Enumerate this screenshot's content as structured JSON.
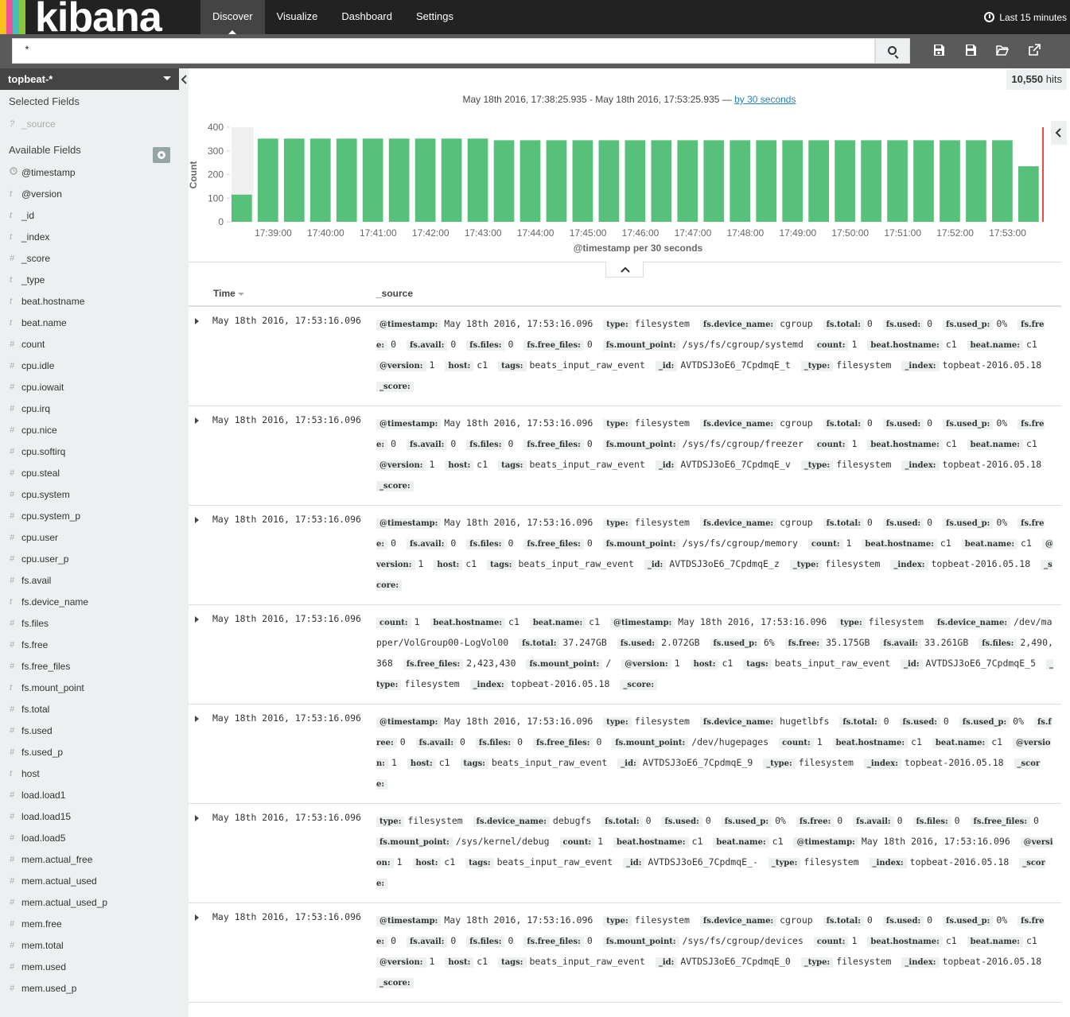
{
  "app": {
    "logo_text": "kibana",
    "logo_colors": [
      "#f9c01e",
      "#ef5098",
      "#49c0b6",
      "#8cc63e"
    ]
  },
  "nav": {
    "items": [
      {
        "label": "Discover",
        "active": true
      },
      {
        "label": "Visualize",
        "active": false
      },
      {
        "label": "Dashboard",
        "active": false
      },
      {
        "label": "Settings",
        "active": false
      }
    ],
    "timepicker": "Last 15 minutes"
  },
  "search": {
    "query": "*",
    "icons": [
      "search-icon",
      "new-search-icon",
      "save-search-icon",
      "open-search-icon",
      "share-search-icon"
    ]
  },
  "sidebar": {
    "index_pattern": "topbeat-*",
    "selected_title": "Selected Fields",
    "selected_fields": [
      {
        "type": "?",
        "name": "_source"
      }
    ],
    "available_title": "Available Fields",
    "available_fields": [
      {
        "type": "clock",
        "name": "@timestamp"
      },
      {
        "type": "t",
        "name": "@version"
      },
      {
        "type": "t",
        "name": "_id"
      },
      {
        "type": "t",
        "name": "_index"
      },
      {
        "type": "#",
        "name": "_score"
      },
      {
        "type": "t",
        "name": "_type"
      },
      {
        "type": "t",
        "name": "beat.hostname"
      },
      {
        "type": "t",
        "name": "beat.name"
      },
      {
        "type": "#",
        "name": "count"
      },
      {
        "type": "#",
        "name": "cpu.idle"
      },
      {
        "type": "#",
        "name": "cpu.iowait"
      },
      {
        "type": "#",
        "name": "cpu.irq"
      },
      {
        "type": "#",
        "name": "cpu.nice"
      },
      {
        "type": "#",
        "name": "cpu.softirq"
      },
      {
        "type": "#",
        "name": "cpu.steal"
      },
      {
        "type": "#",
        "name": "cpu.system"
      },
      {
        "type": "#",
        "name": "cpu.system_p"
      },
      {
        "type": "#",
        "name": "cpu.user"
      },
      {
        "type": "#",
        "name": "cpu.user_p"
      },
      {
        "type": "#",
        "name": "fs.avail"
      },
      {
        "type": "t",
        "name": "fs.device_name"
      },
      {
        "type": "#",
        "name": "fs.files"
      },
      {
        "type": "#",
        "name": "fs.free"
      },
      {
        "type": "#",
        "name": "fs.free_files"
      },
      {
        "type": "t",
        "name": "fs.mount_point"
      },
      {
        "type": "#",
        "name": "fs.total"
      },
      {
        "type": "#",
        "name": "fs.used"
      },
      {
        "type": "#",
        "name": "fs.used_p"
      },
      {
        "type": "t",
        "name": "host"
      },
      {
        "type": "#",
        "name": "load.load1"
      },
      {
        "type": "#",
        "name": "load.load15"
      },
      {
        "type": "#",
        "name": "load.load5"
      },
      {
        "type": "#",
        "name": "mem.actual_free"
      },
      {
        "type": "#",
        "name": "mem.actual_used"
      },
      {
        "type": "#",
        "name": "mem.actual_used_p"
      },
      {
        "type": "#",
        "name": "mem.free"
      },
      {
        "type": "#",
        "name": "mem.total"
      },
      {
        "type": "#",
        "name": "mem.used"
      },
      {
        "type": "#",
        "name": "mem.used_p"
      }
    ]
  },
  "results": {
    "hits_count": "10,550",
    "hits_label": "hits",
    "date_range": "May 18th 2016, 17:38:25.935 - May 18th 2016, 17:53:25.935 —",
    "interval_link": "by 30 seconds"
  },
  "chart_data": {
    "type": "bar",
    "ylabel": "Count",
    "xlabel": "@timestamp per 30 seconds",
    "ylim": [
      0,
      400
    ],
    "yticks": [
      0,
      100,
      200,
      300,
      400
    ],
    "xticks": [
      "17:39:00",
      "17:40:00",
      "17:41:00",
      "17:42:00",
      "17:43:00",
      "17:44:00",
      "17:45:00",
      "17:46:00",
      "17:47:00",
      "17:48:00",
      "17:49:00",
      "17:50:00",
      "17:51:00",
      "17:52:00",
      "17:53:00"
    ],
    "values": [
      115,
      352,
      352,
      352,
      352,
      352,
      352,
      352,
      352,
      352,
      345,
      345,
      345,
      345,
      345,
      345,
      345,
      345,
      345,
      345,
      345,
      345,
      345,
      345,
      345,
      345,
      345,
      345,
      345,
      345,
      235
    ],
    "bar_color": "#57c17b",
    "partial_color": "#f0f0f0",
    "now_marker_color": "#e74c3c"
  },
  "table": {
    "col_time": "Time",
    "col_source": "_source",
    "rows": [
      {
        "time": "May 18th 2016, 17:53:16.096",
        "fields": [
          [
            "@timestamp:",
            "May 18th 2016, 17:53:16.096"
          ],
          [
            "type:",
            "filesystem"
          ],
          [
            "fs.device_name:",
            "cgroup"
          ],
          [
            "fs.total:",
            "0"
          ],
          [
            "fs.used:",
            "0"
          ],
          [
            "fs.used_p:",
            "0%"
          ],
          [
            "fs.free:",
            "0"
          ],
          [
            "fs.avail:",
            "0"
          ],
          [
            "fs.files:",
            "0"
          ],
          [
            "fs.free_files:",
            "0"
          ],
          [
            "fs.mount_point:",
            "/sys/fs/cgroup/systemd"
          ],
          [
            "count:",
            "1"
          ],
          [
            "beat.hostname:",
            "c1"
          ],
          [
            "beat.name:",
            "c1"
          ],
          [
            "@version:",
            "1"
          ],
          [
            "host:",
            "c1"
          ],
          [
            "tags:",
            "beats_input_raw_event"
          ],
          [
            "_id:",
            "AVTDSJ3oE6_7CpdmqE_t"
          ],
          [
            "_type:",
            "filesystem"
          ],
          [
            "_index:",
            "topbeat-2016.05.18"
          ],
          [
            "_score:",
            ""
          ]
        ]
      },
      {
        "time": "May 18th 2016, 17:53:16.096",
        "fields": [
          [
            "@timestamp:",
            "May 18th 2016, 17:53:16.096"
          ],
          [
            "type:",
            "filesystem"
          ],
          [
            "fs.device_name:",
            "cgroup"
          ],
          [
            "fs.total:",
            "0"
          ],
          [
            "fs.used:",
            "0"
          ],
          [
            "fs.used_p:",
            "0%"
          ],
          [
            "fs.free:",
            "0"
          ],
          [
            "fs.avail:",
            "0"
          ],
          [
            "fs.files:",
            "0"
          ],
          [
            "fs.free_files:",
            "0"
          ],
          [
            "fs.mount_point:",
            "/sys/fs/cgroup/freezer"
          ],
          [
            "count:",
            "1"
          ],
          [
            "beat.hostname:",
            "c1"
          ],
          [
            "beat.name:",
            "c1"
          ],
          [
            "@version:",
            "1"
          ],
          [
            "host:",
            "c1"
          ],
          [
            "tags:",
            "beats_input_raw_event"
          ],
          [
            "_id:",
            "AVTDSJ3oE6_7CpdmqE_v"
          ],
          [
            "_type:",
            "filesystem"
          ],
          [
            "_index:",
            "topbeat-2016.05.18"
          ],
          [
            "_score:",
            ""
          ]
        ]
      },
      {
        "time": "May 18th 2016, 17:53:16.096",
        "fields": [
          [
            "@timestamp:",
            "May 18th 2016, 17:53:16.096"
          ],
          [
            "type:",
            "filesystem"
          ],
          [
            "fs.device_name:",
            "cgroup"
          ],
          [
            "fs.total:",
            "0"
          ],
          [
            "fs.used:",
            "0"
          ],
          [
            "fs.used_p:",
            "0%"
          ],
          [
            "fs.free:",
            "0"
          ],
          [
            "fs.avail:",
            "0"
          ],
          [
            "fs.files:",
            "0"
          ],
          [
            "fs.free_files:",
            "0"
          ],
          [
            "fs.mount_point:",
            "/sys/fs/cgroup/memory"
          ],
          [
            "count:",
            "1"
          ],
          [
            "beat.hostname:",
            "c1"
          ],
          [
            "beat.name:",
            "c1"
          ],
          [
            "@version:",
            "1"
          ],
          [
            "host:",
            "c1"
          ],
          [
            "tags:",
            "beats_input_raw_event"
          ],
          [
            "_id:",
            "AVTDSJ3oE6_7CpdmqE_z"
          ],
          [
            "_type:",
            "filesystem"
          ],
          [
            "_index:",
            "topbeat-2016.05.18"
          ],
          [
            "_score:",
            ""
          ]
        ]
      },
      {
        "time": "May 18th 2016, 17:53:16.096",
        "fields": [
          [
            "count:",
            "1"
          ],
          [
            "beat.hostname:",
            "c1"
          ],
          [
            "beat.name:",
            "c1"
          ],
          [
            "@timestamp:",
            "May 18th 2016, 17:53:16.096"
          ],
          [
            "type:",
            "filesystem"
          ],
          [
            "fs.device_name:",
            "/dev/mapper/VolGroup00-LogVol00"
          ],
          [
            "fs.total:",
            "37.247GB"
          ],
          [
            "fs.used:",
            "2.072GB"
          ],
          [
            "fs.used_p:",
            "6%"
          ],
          [
            "fs.free:",
            "35.175GB"
          ],
          [
            "fs.avail:",
            "33.261GB"
          ],
          [
            "fs.files:",
            "2,490,368"
          ],
          [
            "fs.free_files:",
            "2,423,430"
          ],
          [
            "fs.mount_point:",
            "/"
          ],
          [
            "@version:",
            "1"
          ],
          [
            "host:",
            "c1"
          ],
          [
            "tags:",
            "beats_input_raw_event"
          ],
          [
            "_id:",
            "AVTDSJ3oE6_7CpdmqE_5"
          ],
          [
            "_type:",
            "filesystem"
          ],
          [
            "_index:",
            "topbeat-2016.05.18"
          ],
          [
            "_score:",
            ""
          ]
        ]
      },
      {
        "time": "May 18th 2016, 17:53:16.096",
        "fields": [
          [
            "@timestamp:",
            "May 18th 2016, 17:53:16.096"
          ],
          [
            "type:",
            "filesystem"
          ],
          [
            "fs.device_name:",
            "hugetlbfs"
          ],
          [
            "fs.total:",
            "0"
          ],
          [
            "fs.used:",
            "0"
          ],
          [
            "fs.used_p:",
            "0%"
          ],
          [
            "fs.free:",
            "0"
          ],
          [
            "fs.avail:",
            "0"
          ],
          [
            "fs.files:",
            "0"
          ],
          [
            "fs.free_files:",
            "0"
          ],
          [
            "fs.mount_point:",
            "/dev/hugepages"
          ],
          [
            "count:",
            "1"
          ],
          [
            "beat.hostname:",
            "c1"
          ],
          [
            "beat.name:",
            "c1"
          ],
          [
            "@version:",
            "1"
          ],
          [
            "host:",
            "c1"
          ],
          [
            "tags:",
            "beats_input_raw_event"
          ],
          [
            "_id:",
            "AVTDSJ3oE6_7CpdmqE_9"
          ],
          [
            "_type:",
            "filesystem"
          ],
          [
            "_index:",
            "topbeat-2016.05.18"
          ],
          [
            "_score:",
            ""
          ]
        ]
      },
      {
        "time": "May 18th 2016, 17:53:16.096",
        "fields": [
          [
            "type:",
            "filesystem"
          ],
          [
            "fs.device_name:",
            "debugfs"
          ],
          [
            "fs.total:",
            "0"
          ],
          [
            "fs.used:",
            "0"
          ],
          [
            "fs.used_p:",
            "0%"
          ],
          [
            "fs.free:",
            "0"
          ],
          [
            "fs.avail:",
            "0"
          ],
          [
            "fs.files:",
            "0"
          ],
          [
            "fs.free_files:",
            "0"
          ],
          [
            "fs.mount_point:",
            "/sys/kernel/debug"
          ],
          [
            "count:",
            "1"
          ],
          [
            "beat.hostname:",
            "c1"
          ],
          [
            "beat.name:",
            "c1"
          ],
          [
            "@timestamp:",
            "May 18th 2016, 17:53:16.096"
          ],
          [
            "@version:",
            "1"
          ],
          [
            "host:",
            "c1"
          ],
          [
            "tags:",
            "beats_input_raw_event"
          ],
          [
            "_id:",
            "AVTDSJ3oE6_7CpdmqE_-"
          ],
          [
            "_type:",
            "filesystem"
          ],
          [
            "_index:",
            "topbeat-2016.05.18"
          ],
          [
            "_score:",
            ""
          ]
        ]
      },
      {
        "time": "May 18th 2016, 17:53:16.096",
        "fields": [
          [
            "@timestamp:",
            "May 18th 2016, 17:53:16.096"
          ],
          [
            "type:",
            "filesystem"
          ],
          [
            "fs.device_name:",
            "cgroup"
          ],
          [
            "fs.total:",
            "0"
          ],
          [
            "fs.used:",
            "0"
          ],
          [
            "fs.used_p:",
            "0%"
          ],
          [
            "fs.free:",
            "0"
          ],
          [
            "fs.avail:",
            "0"
          ],
          [
            "fs.files:",
            "0"
          ],
          [
            "fs.free_files:",
            "0"
          ],
          [
            "fs.mount_point:",
            "/sys/fs/cgroup/devices"
          ],
          [
            "count:",
            "1"
          ],
          [
            "beat.hostname:",
            "c1"
          ],
          [
            "beat.name:",
            "c1"
          ],
          [
            "@version:",
            "1"
          ],
          [
            "host:",
            "c1"
          ],
          [
            "tags:",
            "beats_input_raw_event"
          ],
          [
            "_id:",
            "AVTDSJ3oE6_7CpdmqE_0"
          ],
          [
            "_type:",
            "filesystem"
          ],
          [
            "_index:",
            "topbeat-2016.05.18"
          ],
          [
            "_score:",
            ""
          ]
        ]
      }
    ]
  }
}
